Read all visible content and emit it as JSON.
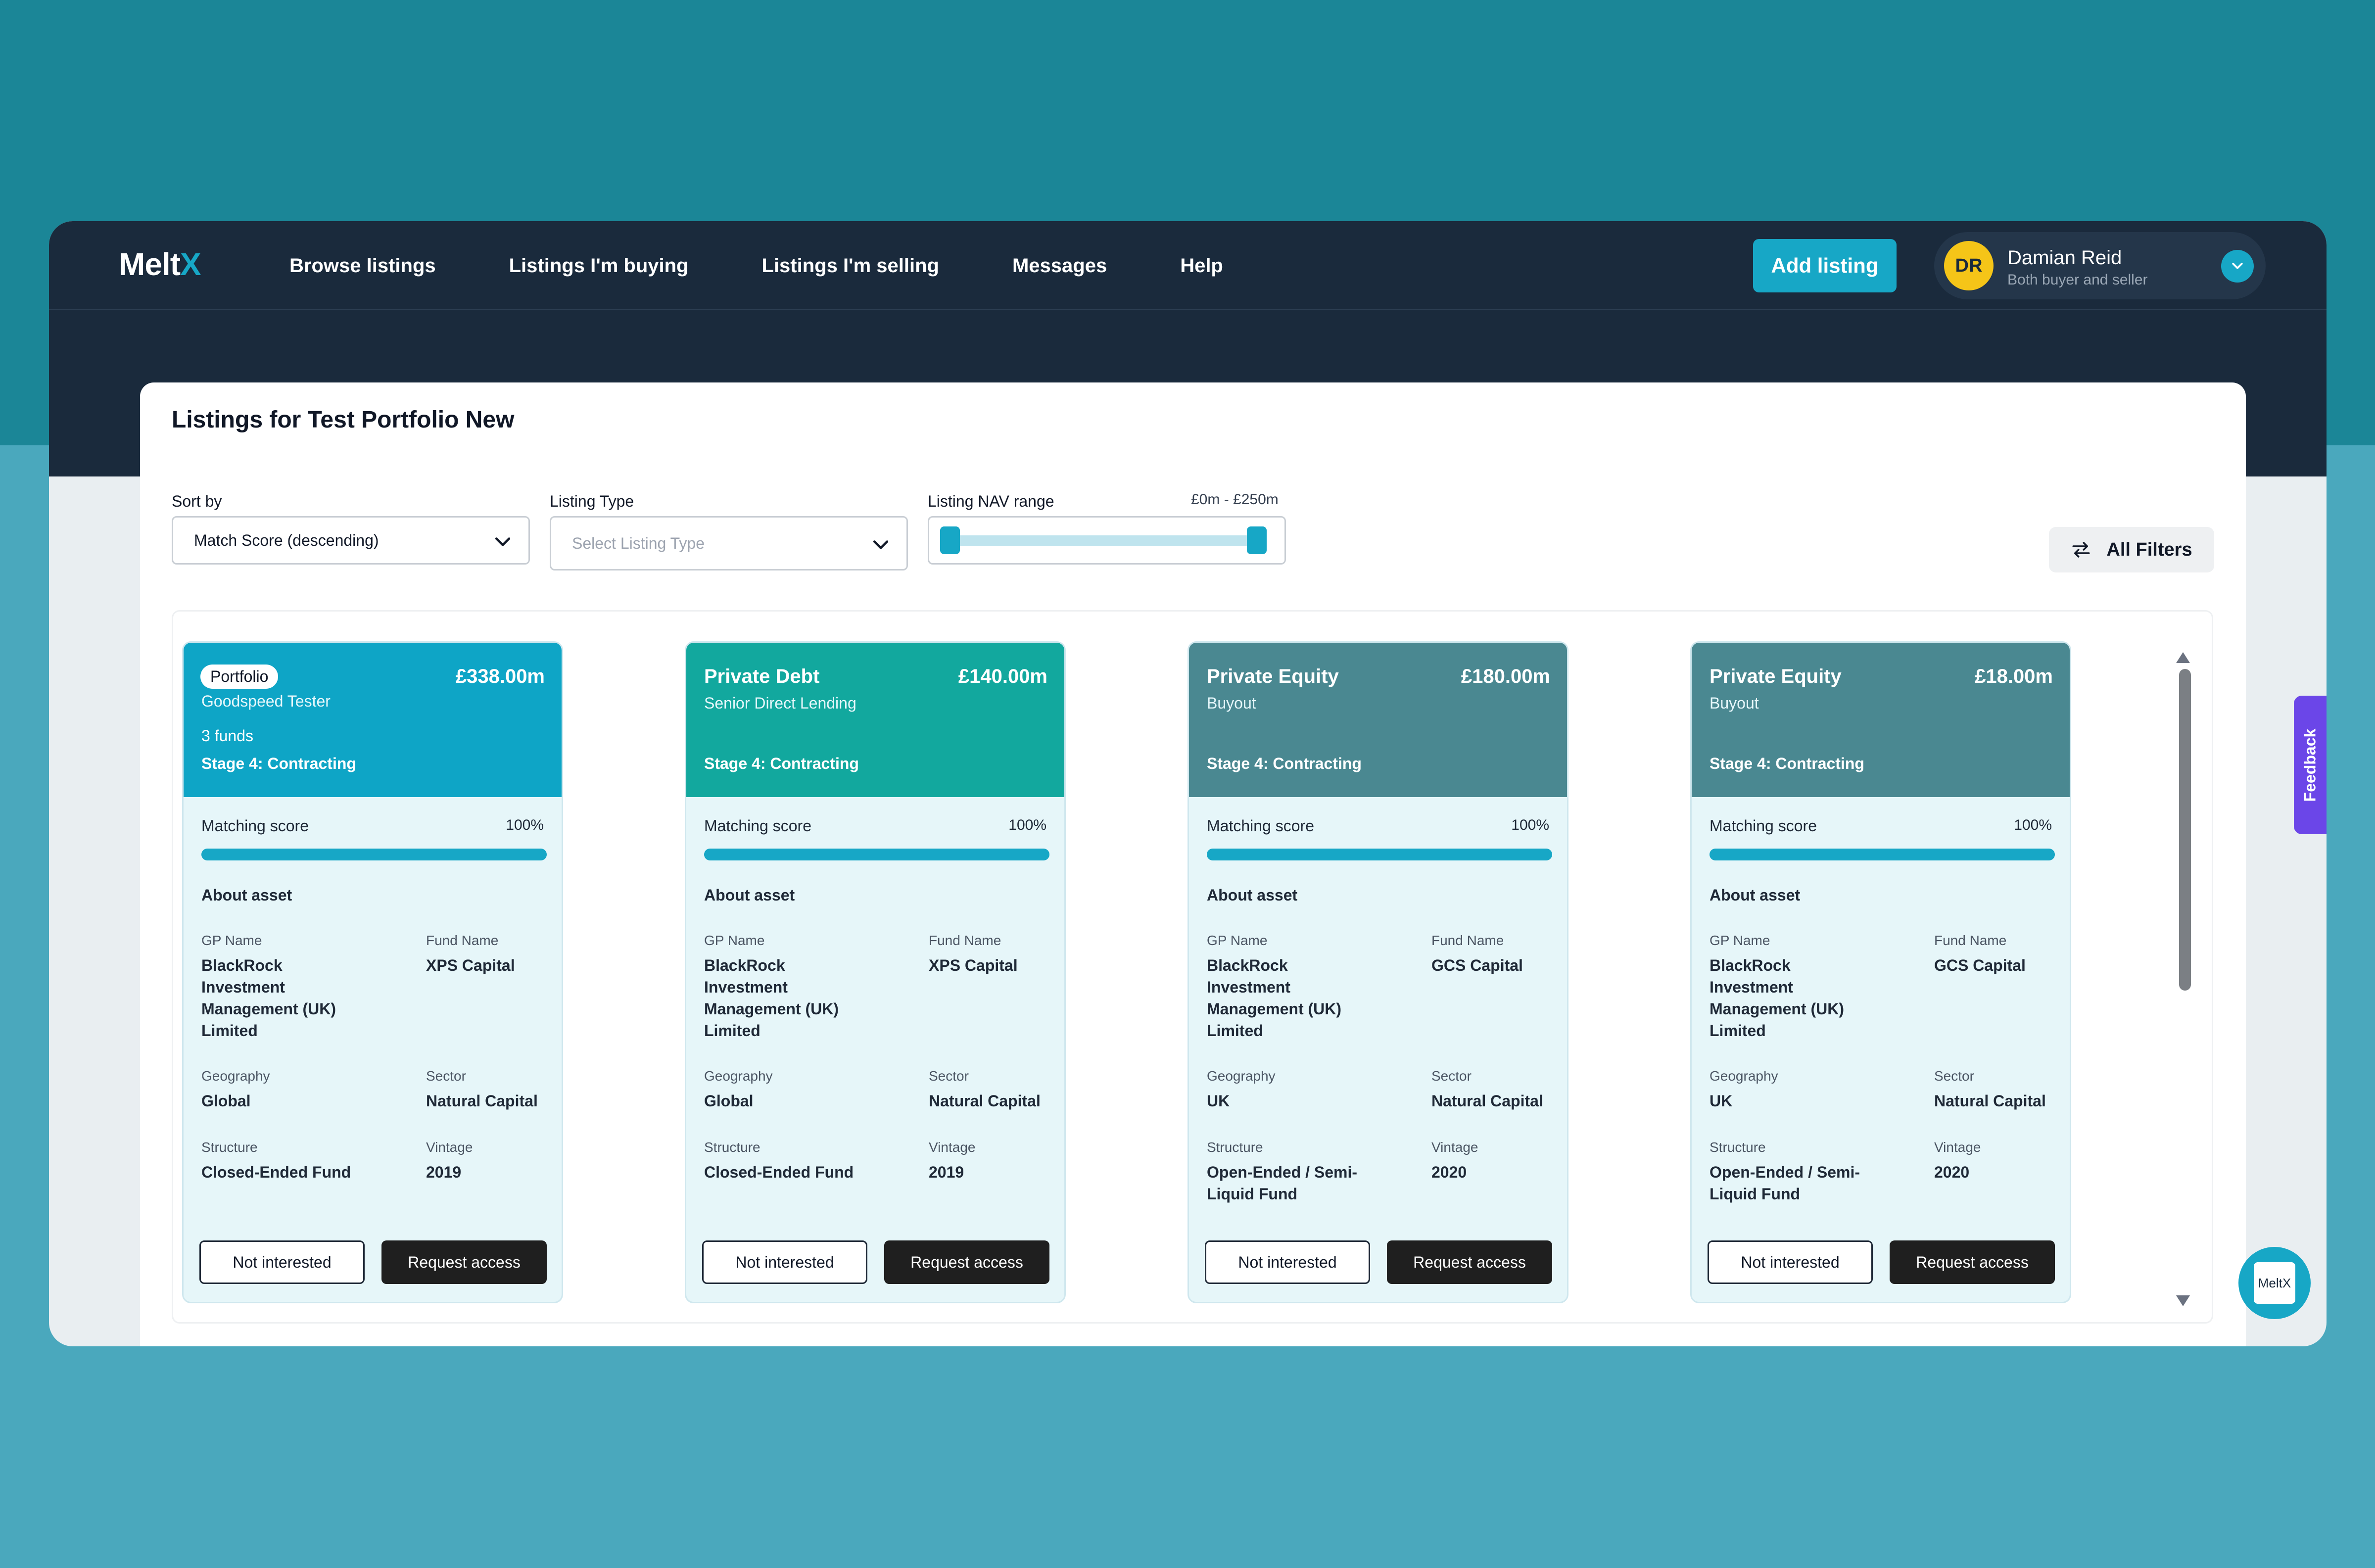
{
  "brand": {
    "logo_main": "Melt",
    "logo_accent": "X"
  },
  "nav": {
    "links": [
      "Browse listings",
      "Listings I'm buying",
      "Listings I'm selling",
      "Messages",
      "Help"
    ],
    "add_listing": "Add listing"
  },
  "user": {
    "initials": "DR",
    "name": "Damian Reid",
    "role": "Both buyer and seller"
  },
  "panel": {
    "title": "Listings for Test Portfolio New",
    "sort_label": "Sort by",
    "sort_value": "Match Score (descending)",
    "type_label": "Listing Type",
    "type_placeholder": "Select Listing Type",
    "nav_label": "Listing NAV range",
    "nav_value": "£0m - £250m",
    "all_filters": "All Filters"
  },
  "labels": {
    "matching_score": "Matching score",
    "about": "About asset",
    "gp_name": "GP Name",
    "fund_name": "Fund Name",
    "geography": "Geography",
    "sector": "Sector",
    "structure": "Structure",
    "vintage": "Vintage",
    "not_interested": "Not interested",
    "request_access": "Request access"
  },
  "cards": [
    {
      "badge": "Portfolio",
      "type": "",
      "subtitle": "Goodspeed Tester",
      "funds": "3 funds",
      "value": "£338.00m",
      "stage": "Stage 4: Contracting",
      "score": "100%",
      "score_fraction": 1.0,
      "color": "#0ea5c6",
      "gp_name": "BlackRock Investment Management (UK) Limited",
      "fund_name": "XPS Capital",
      "geography": "Global",
      "sector": "Natural Capital",
      "structure": "Closed-Ended Fund",
      "vintage": "2019"
    },
    {
      "badge": "",
      "type": "Private Debt",
      "subtitle": "Senior Direct Lending",
      "funds": "",
      "value": "£140.00m",
      "stage": "Stage 4: Contracting",
      "score": "100%",
      "score_fraction": 1.0,
      "color": "#12a89e",
      "gp_name": "BlackRock Investment Management (UK) Limited",
      "fund_name": "XPS Capital",
      "geography": "Global",
      "sector": "Natural Capital",
      "structure": "Closed-Ended Fund",
      "vintage": "2019"
    },
    {
      "badge": "",
      "type": "Private Equity",
      "subtitle": "Buyout",
      "funds": "",
      "value": "£180.00m",
      "stage": "Stage 4: Contracting",
      "score": "100%",
      "score_fraction": 1.0,
      "color": "#4a8891",
      "gp_name": "BlackRock Investment Management (UK) Limited",
      "fund_name": "GCS Capital",
      "geography": "UK",
      "sector": "Natural Capital",
      "structure": "Open-Ended / Semi-Liquid Fund",
      "vintage": "2020"
    },
    {
      "badge": "",
      "type": "Private Equity",
      "subtitle": "Buyout",
      "funds": "",
      "value": "£18.00m",
      "stage": "Stage 4: Contracting",
      "score": "100%",
      "score_fraction": 1.0,
      "color": "#4a8891",
      "gp_name": "BlackRock Investment Management (UK) Limited",
      "fund_name": "GCS Capital",
      "geography": "UK",
      "sector": "Natural Capital",
      "structure": "Open-Ended / Semi-Liquid Fund",
      "vintage": "2020"
    }
  ],
  "feedback": "Feedback",
  "chat": {
    "label": "MeltX"
  },
  "icons": {
    "sort_chevron": "chevron-down-icon",
    "user_chevron": "chevron-down-icon",
    "filters": "swap-arrows-icon",
    "scroll_up": "triangle-up-icon",
    "scroll_down": "triangle-down-icon"
  },
  "colors": {
    "accent": "#17a7c6",
    "nav_bg": "#1a2a3c",
    "feedback": "#6b46e8"
  }
}
